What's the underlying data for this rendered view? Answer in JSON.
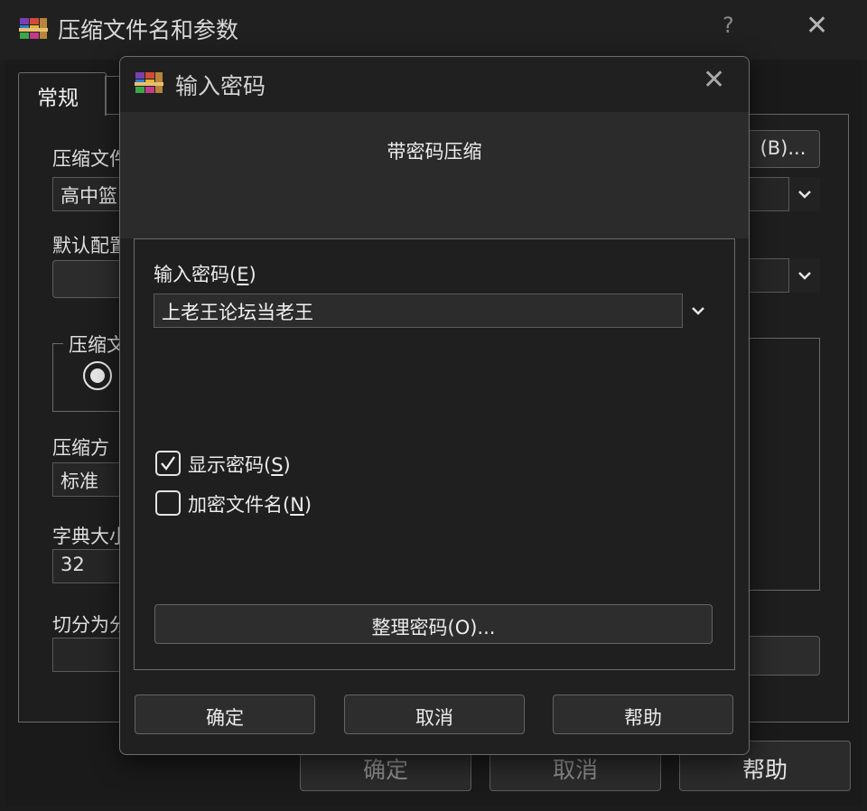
{
  "parent_window": {
    "title": "压缩文件名和参数",
    "help_glyph": "?",
    "close_glyph": "✕",
    "tabs": [
      "常规"
    ],
    "archive_name_label": "压缩文件",
    "archive_name_value": "高中篮",
    "browse_button": "(B)...",
    "default_profile_label": "默认配置",
    "archive_format_label": "压缩文",
    "compression_method_label": "压缩方",
    "compression_method_value": "标准",
    "dictionary_size_label": "字典大小",
    "dictionary_size_value": "32",
    "split_volumes_label": "切分为分",
    "buttons": {
      "ok": "确定",
      "cancel": "取消",
      "help": "帮助"
    }
  },
  "dialog": {
    "title": "输入密码",
    "close_glyph": "✕",
    "heading": "带密码压缩",
    "password_label": "输入密码",
    "password_hotkey": "E",
    "password_value": "上老王论坛当老王",
    "show_password": {
      "label": "显示密码",
      "hotkey": "S",
      "checked": true
    },
    "encrypt_filenames": {
      "label": "加密文件名",
      "hotkey": "N",
      "checked": false
    },
    "organize_button": "整理密码(O)...",
    "buttons": {
      "ok": "确定",
      "cancel": "取消",
      "help": "帮助"
    }
  }
}
